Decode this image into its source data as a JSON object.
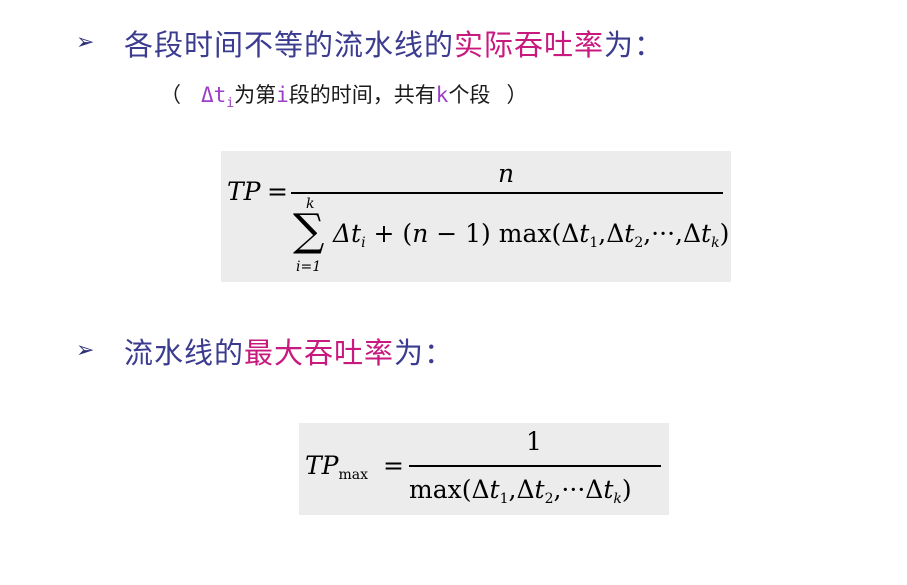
{
  "heading1": {
    "bullet": "➢",
    "text_plain": "各段时间不等的流水线的",
    "text_highlight": "实际吞吐率",
    "text_tail": "为："
  },
  "note": {
    "open_paren": "（",
    "delta_t": "Δt",
    "sub_i": "i",
    "text1": "为第",
    "i": "i",
    "text2": "段的时间，共有",
    "k": "k",
    "text3": "个段",
    "close_paren": "）"
  },
  "formula1": {
    "lhs": "TP",
    "equals": "=",
    "numerator": "n",
    "sum_upper": "k",
    "sum_lower": "i=1",
    "sum_symbol": "∑",
    "denominator_part1": "Δt",
    "denominator_sub_i": "i",
    "denominator_part2": " + (",
    "n": "n",
    "denominator_part3": " − 1) max(Δ",
    "t1": "t",
    "sub1": "1",
    "comma1": ",Δ",
    "t2": "t",
    "sub2": "2",
    "dots": ",···,Δ",
    "tk": "t",
    "subk": "k",
    "close": ")"
  },
  "heading2": {
    "bullet": "➢",
    "text_plain": "流水线的",
    "text_highlight": "最大吞吐率",
    "text_tail": "为："
  },
  "formula2": {
    "lhs": "TP",
    "lhs_sub": "max",
    "equals": "=",
    "numerator": "1",
    "den_part1": "max(Δ",
    "t1": "t",
    "sub1": "1",
    "comma1": ",Δ",
    "t2": "t",
    "sub2": "2",
    "dots": ",···Δ",
    "tk": "t",
    "subk": "k",
    "close": ")"
  },
  "colors": {
    "heading": "#3b3b8f",
    "highlight": "#c8197f",
    "variable": "#9b3fc7",
    "formula_bg": "#ececec"
  }
}
